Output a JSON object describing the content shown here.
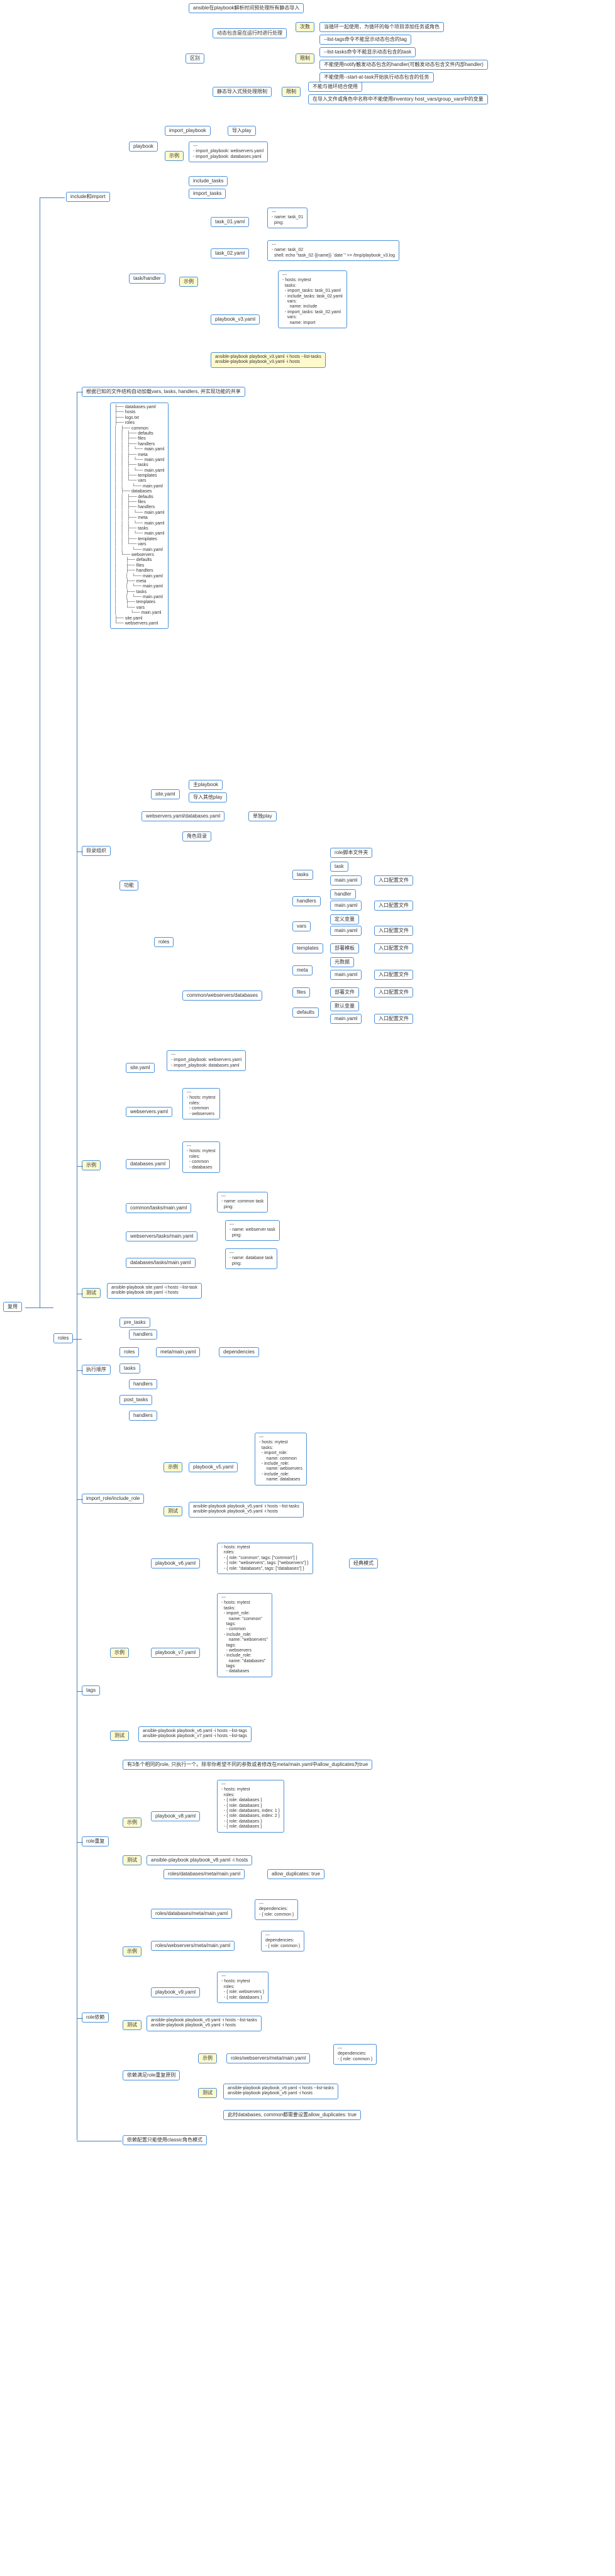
{
  "title_top": "ansible在playbook解析时间预处理所有静态导入",
  "root": "复用",
  "区别": "区别",
  "动态预处理": "动态包含是在运行时进行处理",
  "次数": "次数",
  "次数txt": "当循环一起使用，为循环的每个项目添加任务或角色",
  "限制": "限制",
  "限制1": "--list-tags命令不能显示动态包含的tag",
  "限制2": "--list-tasks命令不能显示动态包含的task",
  "限制3": "不能使用notify触发动态包含的handler(可触发动态包含文件内部handler)",
  "限制4": "不能使用--start-at-task开始执行动态包含的任务",
  "静态导入": "静态导入式预处理限制",
  "限制5": "不能与循环结合使用",
  "限制6": "在导入文件或角色中名称中不能使用inventory host_vars/group_vars中的变量",
  "incimp": "include和import",
  "playbook": "playbook",
  "import_playbook": "import_playbook",
  "示例": "示例",
  "导入play": "导入play",
  "示例pb": "---\n- import_playbook: webservers.yaml\n- import_playbook: databases.yaml",
  "include_tasks": "include_tasks",
  "import_tasks": "import_tasks",
  "task_handler": "task/handler",
  "task01": "task_01.yaml",
  "task01txt": "---\n- name: task_01\n  ping:",
  "task02": "task_02.yaml",
  "task02txt": "---\n- name: task_02\n  shell: echo \"task_02 {{name}} `date`\" >> /tmp/playbook_v3.log",
  "pbv3": "playbook_v3.yaml",
  "pbv3txt": "---\n- hosts: mytest\n  tasks:\n  - import_tasks: task_01.yaml\n  - include_tasks: task_02.yaml\n    vars:\n      name: include\n  - import_tasks: task_02.yaml\n    vars:\n      name: import",
  "pbv3cmd": "ansible-playbook playbook_v3.yaml -i hosts --list-tasks\nansible-playbook playbook_v3.yaml -i hosts",
  "roles": "roles",
  "rolesdesc": "根据已知的文件结构自动加载vars, tasks, handlers, 并实现功能的共享",
  "dirtree": "├── databases.yaml\n├── hosts\n├── logs.txt\n├── roles\n│   ├── common\n│   │   ├── defaults\n│   │   ├── files\n│   │   ├── handlers\n│   │   │   └── main.yaml\n│   │   ├── meta\n│   │   │   └── main.yaml\n│   │   ├── tasks\n│   │   │   └── main.yaml\n│   │   ├── templates\n│   │   └── vars\n│   │       └── main.yaml\n│   ├── databases\n│   │   ├── defaults\n│   │   ├── files\n│   │   ├── handlers\n│   │   │   └── main.yaml\n│   │   ├── meta\n│   │   │   └── main.yaml\n│   │   ├── tasks\n│   │   │   └── main.yaml\n│   │   ├── templates\n│   │   └── vars\n│   │       └── main.yaml\n│   └── webservers\n│       ├── defaults\n│       ├── files\n│       ├── handlers\n│       │   └── main.yaml\n│       ├── meta\n│       │   └── main.yaml\n│       ├── tasks\n│       │   └── main.yaml\n│       ├── templates\n│       └── vars\n│           └── main.yaml\n├── site.yaml\n└── webservers.yaml",
  "目录": "目录组织",
  "功能": "功能",
  "siteyaml": "site.yaml",
  "主pb": "主playbook",
  "导入其他play": "导入其他play",
  "wsdb": "webservers.yaml/databases.yaml",
  "单独play": "单独play",
  "角色目录": "角色目录",
  "cwd": "common/webservers/databases",
  "rolescript": "role脚本文件夹",
  "task": "task",
  "tasks": "tasks",
  "handler": "handler",
  "handlers": "handlers",
  "定义变量": "定义变量",
  "vars": "vars",
  "部署模板": "部署模板",
  "templates": "templates",
  "元数据": "元数据",
  "meta": "meta",
  "部署文件": "部署文件",
  "files": "files",
  "默认变量": "默认变量",
  "defaults": "defaults",
  "mainyaml": "main.yaml",
  "entry": "入口配置文件",
  "siteymlc": "---\n- import_playbook: webservers.yaml\n- import_playbook: databases.yaml",
  "wsyaml": "---\n- hosts: mytest\n  roles:\n  - common\n  - webservers",
  "dbyaml": "---\n- hosts: mytest\n  roles:\n  - common\n  - databases",
  "commontask": "---\n- name: common task\n  ping:",
  "wstask": "---\n- name: webserver task\n  ping:",
  "dbtask": "---\n- name: database task\n  ping:",
  "ctmain": "common/tasks/main.yaml",
  "wstmain": "webservers/tasks/main.yaml",
  "dbtmain": "databases/tasks/main.yaml",
  "测试": "测试",
  "测试1": "ansible-playbook site.yaml -i hosts --list-task\nansible-playbook site.yaml -i hosts",
  "执行顺序": "执行顺序",
  "pre_tasks": "pre_tasks",
  "roles角色": "roles",
  "metamain": "  meta/main.yaml",
  "dependencies": "dependencies",
  "post_tasks": "post_tasks",
  "irir": "import_role/include_role",
  "pbv5": "playbook_v5.yaml",
  "pbv5txt": "---\n- hosts: mytest\n  tasks:\n  - import_role:\n      name: common\n  - include_role:\n      name: webservers\n  - include_role:\n      name: databases",
  "pbv5cmd": "ansible-playbook playbook_v5.yaml -i hosts --list-tasks\nansible-playbook playbook_v5.yaml -i hosts",
  "tags": "tags",
  "pbv6": "playbook_v6.yaml",
  "pbv6txt": "- hosts: mytest\n  roles:\n  - { role: \"common\", tags: [\"common\"] }\n  - { role: \"webservers\", tags: [\"webservers\"] }\n  - { role: \"databases\", tags: [\"databases\"] }",
  "经典模式": "经典模式",
  "pbv7": "playbook_v7.yaml",
  "pbv7txt": "---\n- hosts: mytest\n  tasks:\n  - import_role:\n      name: \"common\"\n    tags:\n    - common\n  - include_role:\n      name: \"webservers\"\n    tags:\n    - webservers\n  - include_role:\n      name: \"databases\"\n    tags:\n    - databases",
  "pbv67cmd": "ansible-playbook playbook_v6.yaml -i hosts --list-tags\nansible-playbook playbook_v7.yaml -i hosts --list-tags",
  "role重复": "role重复",
  "重复desc": "有3条个相同的role, 只执行一个。除非你希望不同的参数或者修改在meta/main.yaml中allow_duplicates为true",
  "pbv8": "playbook_v8.yaml",
  "pbv8txt": "---\n- hosts: mytest\n  roles:\n  - { role: databases }\n  - { role: databases }\n  - { role: databases, index: 1 }\n  - { role: databases, index: 2 }\n  - { role: databases }\n  - { role: databases }",
  "pbv8cmd": "ansible-playbook playbook_v8.yaml -i hosts",
  "rdbmeta": "roles/databases/meta/main.yaml",
  "allowdup": "allow_duplicates: true",
  "role依赖": "role依赖",
  "示例9": "roles/databases/meta/main.yaml",
  "dep1": "---\ndependencies:\n- { role: common }",
  "dep2": "---\ndependencies:\n- { role: common }",
  "rwsm": "roles/webservers/meta/main.yaml",
  "pbv9": "playbook_v9.yaml",
  "pbv9txt": "---\n- hosts: mytest\n  roles:\n  - { role: webservers }\n  - { role: databases }",
  "pbv9cmd": "ansible-playbook playbook_v9.yaml -i hosts --list-tasks\nansible-playbook playbook_v9.yaml -i hosts",
  "依赖重复": "依赖满足role重复原则",
  "终测": "ansible-playbook playbook_v9.yaml -i hosts --list-tasks\nansible-playbook playbook_v9.yaml -i hosts",
  "此时": "此时databases, common都需要设置allow_duplicates: true",
  "依赖配置": "依赖配置只能使用classic角色模式"
}
